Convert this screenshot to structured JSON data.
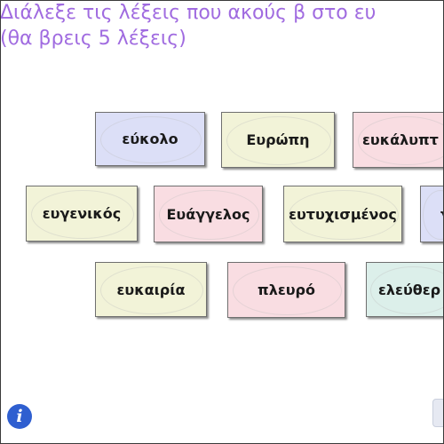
{
  "instructions": {
    "line1": "Διάλεξε τις λέξεις που ακούς β στο ευ",
    "line2": "(θα βρεις 5 λέξεις)"
  },
  "cards": [
    {
      "label": "εύκολο",
      "color": "blue"
    },
    {
      "label": "Ευρώπη",
      "color": "yellow"
    },
    {
      "label": "ευκάλυπτ",
      "color": "pink"
    },
    {
      "label": "ευγενικός",
      "color": "yellow"
    },
    {
      "label": "Ευάγγελος",
      "color": "pink"
    },
    {
      "label": "ευτυχισμένος",
      "color": "yellow"
    },
    {
      "label": "γ",
      "color": "blue"
    },
    {
      "label": "ευκαιρία",
      "color": "yellow"
    },
    {
      "label": "πλευρό",
      "color": "pink"
    },
    {
      "label": "ελεύθερ",
      "color": "green"
    }
  ],
  "info_button": {
    "icon": "info-icon",
    "label": "i"
  },
  "colors": {
    "instruction_text": "#a06be0",
    "card_blue": "#dcdff7",
    "card_yellow": "#f2f3d8",
    "card_pink": "#f9dde2",
    "card_green": "#dcefea",
    "info_button": "#2f5fd0"
  }
}
